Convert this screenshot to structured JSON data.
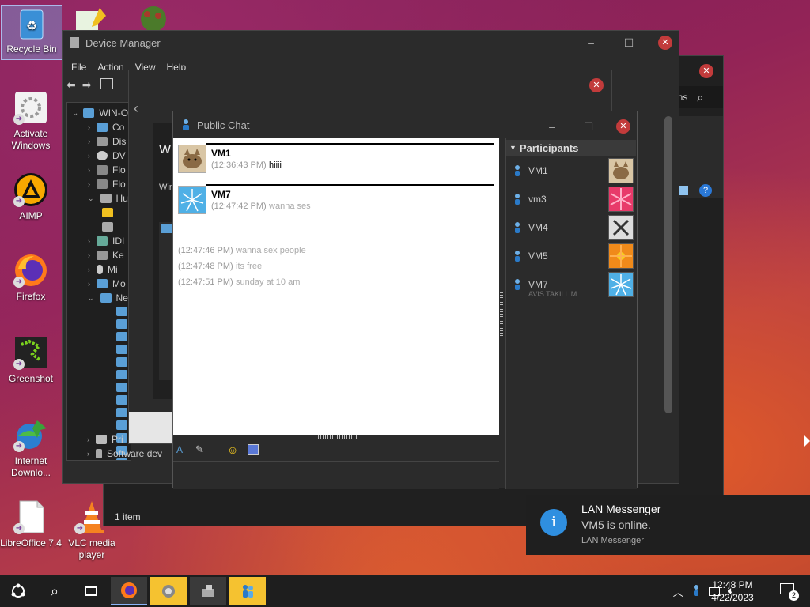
{
  "desktop": {
    "icons": [
      {
        "label": "Recycle Bin",
        "icon": "recycle-bin-icon"
      },
      {
        "label": "Activate Windows",
        "icon": "activate-windows-icon"
      },
      {
        "label": "AIMP",
        "icon": "aimp-icon"
      },
      {
        "label": "Firefox",
        "icon": "firefox-icon"
      },
      {
        "label": "Greenshot",
        "icon": "greenshot-icon"
      },
      {
        "label": "Internet Downlo...",
        "icon": "internet-download-manager-icon"
      },
      {
        "label": "LibreOffice 7.4",
        "icon": "libreoffice-icon"
      },
      {
        "label": "VLC media player",
        "icon": "vlc-icon"
      }
    ]
  },
  "device_manager": {
    "title": "Device Manager",
    "menu": [
      "File",
      "Action",
      "View",
      "Help"
    ],
    "root": "WIN-O",
    "tree": [
      {
        "label": "Co"
      },
      {
        "label": "Dis"
      },
      {
        "label": "DV"
      },
      {
        "label": "Flo"
      },
      {
        "label": "Flo"
      },
      {
        "label": "Hu"
      },
      {
        "label": ""
      },
      {
        "label": ""
      },
      {
        "label": "IDI"
      },
      {
        "label": "Ke"
      },
      {
        "label": "Mi"
      },
      {
        "label": "Mo"
      },
      {
        "label": "Ne"
      }
    ],
    "bottom_rows": [
      {
        "label": "Pri"
      },
      {
        "label": "Software dev"
      }
    ]
  },
  "explorer_window": {
    "status": "1 item",
    "search_fragment": "ons"
  },
  "update_driver": {
    "heading_fragment": "Wi",
    "sub_fragment": "Win"
  },
  "public_chat": {
    "title": "Public Chat",
    "messages": [
      {
        "sender": "VM1",
        "lines": [
          {
            "time": "(12:36:43 PM)",
            "text": "hiiii",
            "dark": true
          }
        ]
      },
      {
        "sender": "VM7",
        "lines": [
          {
            "time": "(12:47:42 PM)",
            "text": "wanna ses",
            "dark": false
          },
          {
            "time": "(12:47:46 PM)",
            "text": "wanna sex people",
            "dark": false
          },
          {
            "time": "(12:47:48 PM)",
            "text": "its free",
            "dark": false
          },
          {
            "time": "(12:47:51 PM)",
            "text": "sunday at 10 am",
            "dark": false
          }
        ]
      }
    ],
    "participants_header": "Participants",
    "participants": [
      {
        "name": "VM1",
        "status": ""
      },
      {
        "name": "vm3",
        "status": ""
      },
      {
        "name": "VM4",
        "status": ""
      },
      {
        "name": "VM5",
        "status": ""
      },
      {
        "name": "VM7",
        "status": "AVIS TAKILL M..."
      }
    ]
  },
  "notification": {
    "title": "LAN Messenger",
    "message": "VM5 is online.",
    "source": "LAN Messenger"
  },
  "taskbar": {
    "time": "12:48 PM",
    "date": "4/22/2023",
    "notification_count": "2"
  }
}
